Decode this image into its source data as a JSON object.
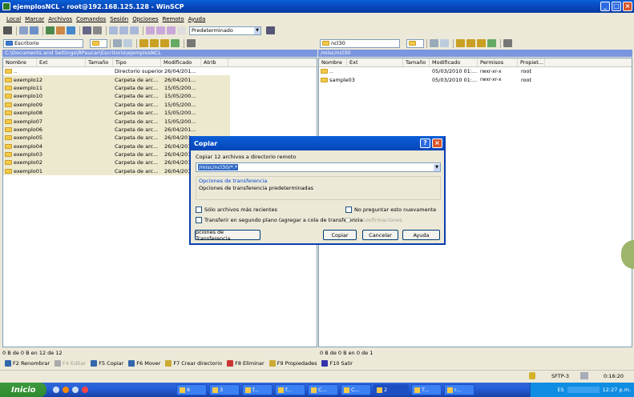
{
  "window": {
    "title": "ejemplosNCL - root@192.168.125.128 - WinSCP"
  },
  "menu": [
    "Local",
    "Marcar",
    "Archivos",
    "Comandos",
    "Sesión",
    "Opciones",
    "Remoto",
    "Ayuda"
  ],
  "toolbar": {
    "transfer_preset": "Predeterminado"
  },
  "left": {
    "location": "Escritorio",
    "path": "C:\\Documents and Settings\\RPaucar\\Escritorio\\ejemplosNCL",
    "columns": [
      "Nombre",
      "Ext",
      "Tamaño",
      "Tipo",
      "Modificado",
      "Atrib"
    ],
    "rows": [
      {
        "name": "..",
        "type": "Directorio superior",
        "modified": "26/04/201..."
      },
      {
        "name": "exemplo12",
        "type": "Carpeta de arc...",
        "modified": "26/04/201..."
      },
      {
        "name": "exemplo11",
        "type": "Carpeta de arc...",
        "modified": "15/05/200..."
      },
      {
        "name": "exemplo10",
        "type": "Carpeta de arc...",
        "modified": "15/05/200..."
      },
      {
        "name": "exemplo09",
        "type": "Carpeta de arc...",
        "modified": "15/05/200..."
      },
      {
        "name": "exemplo08",
        "type": "Carpeta de arc...",
        "modified": "15/05/200..."
      },
      {
        "name": "exemplo07",
        "type": "Carpeta de arc...",
        "modified": "15/05/200..."
      },
      {
        "name": "exemplo06",
        "type": "Carpeta de arc...",
        "modified": "26/04/201..."
      },
      {
        "name": "exemplo05",
        "type": "Carpeta de arc...",
        "modified": "26/04/201..."
      },
      {
        "name": "exemplo04",
        "type": "Carpeta de arc...",
        "modified": "26/04/201..."
      },
      {
        "name": "exemplo03",
        "type": "Carpeta de arc...",
        "modified": "26/04/201..."
      },
      {
        "name": "exemplo02",
        "type": "Carpeta de arc...",
        "modified": "26/04/201..."
      },
      {
        "name": "exemplo01",
        "type": "Carpeta de arc...",
        "modified": "26/04/201..."
      }
    ],
    "status": "0 B de 0 B en 12 de 12"
  },
  "right": {
    "location": "ncl30",
    "path": "/misc/ncl30",
    "columns": [
      "Nombre",
      "Ext",
      "Tamaño",
      "Modificado",
      "Permisos",
      "Propiet..."
    ],
    "rows": [
      {
        "name": "..",
        "modified": "05/03/2010 01:...",
        "perms": "rwxr-xr-x",
        "owner": "root"
      },
      {
        "name": "sample03",
        "modified": "05/03/2010 01:...",
        "perms": "rwxr-xr-x",
        "owner": "root"
      }
    ],
    "status": "0 B de 0 B en 0 de 1"
  },
  "dialog": {
    "title": "Copiar",
    "prompt": "Copiar 12 archivos a directorio remoto",
    "target": "/misc/ncl30/*.*",
    "group_title": "Opciones de transferencia",
    "group_text": "Opciones de transferencia predeterminadas",
    "chk_recent": "Sólo archivos más recientes",
    "chk_noask": "No preguntar esto nuevamente",
    "chk_background": "Transferir en segundo plano (agregar a cola de transferencia",
    "chk_noconfirm": "Sin confirmaciones",
    "btn_options": "pciones de Transferencia",
    "btn_copy": "Copiar",
    "btn_cancel": "Cancelar",
    "btn_help": "Ayuda"
  },
  "fkeys": [
    "F2 Renombrar",
    "F4 Editar",
    "F5 Copiar",
    "F6 Mover",
    "F7 Crear directorio",
    "F8 Eliminar",
    "F9 Propiedades",
    "F10 Salir"
  ],
  "bottom": {
    "protocol": "SFTP-3",
    "time": "0:16:20"
  },
  "taskbar": {
    "start": "Inicio",
    "tasks": [
      "6",
      "3",
      "f...",
      "f...",
      "C...",
      "C...",
      "2",
      "T...",
      "r..."
    ],
    "lang": "ES",
    "clock": "12:27 p.m."
  }
}
